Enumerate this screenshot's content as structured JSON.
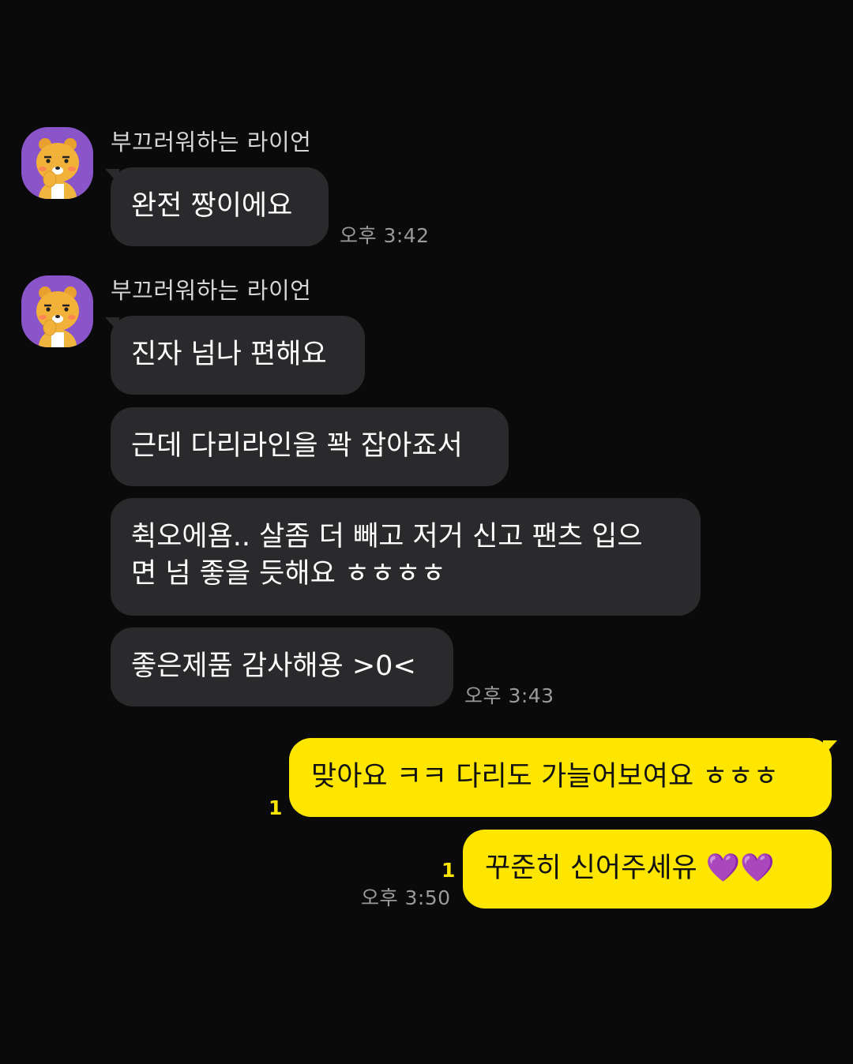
{
  "colors": {
    "background": "#0a0a0a",
    "incoming_bubble": "#2a2a2c",
    "outgoing_bubble": "#ffe600",
    "unread_count": "#ffe600",
    "avatar_bg": "#8a55c9"
  },
  "messages": {
    "group1": {
      "sender": "부끄러워하는 라이언",
      "avatar_icon": "ryan-shy-avatar-icon",
      "bubbles": [
        "완전 짱이에요"
      ],
      "time": "오후 3:42"
    },
    "group2": {
      "sender": "부끄러워하는 라이언",
      "avatar_icon": "ryan-shy-avatar-icon",
      "bubbles": [
        "진자 넘나 편해요",
        "근데 다리라인을 꽉 잡아죠서",
        [
          "췩오에욤.. 살좀 더 빼고 저거 신고 팬츠 입으",
          "면 넘 좋을 듯해요 ㅎㅎㅎㅎ"
        ],
        "좋은제품 감사해용 >0<"
      ],
      "time": "오후 3:43"
    },
    "mine": {
      "bubbles": [
        "맞아요 ㅋㅋ 다리도 가늘어보여요 ㅎㅎㅎ",
        "꾸준히 신어주세유 💜💜"
      ],
      "unread": [
        "1",
        "1"
      ],
      "time": "오후 3:50",
      "heart_icon": "purple-heart-icon"
    }
  }
}
